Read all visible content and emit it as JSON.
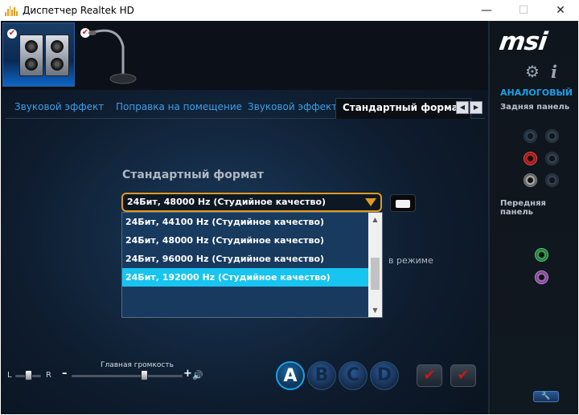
{
  "window": {
    "title": "Диспетчер Realtek HD",
    "minimize_symbol": "—",
    "maximize_symbol": "☐",
    "close_symbol": "✕"
  },
  "devices": [
    {
      "name": "speakers",
      "checked": true,
      "selected": true
    },
    {
      "name": "microphone",
      "checked": true,
      "selected": false
    }
  ],
  "tabs": [
    {
      "label": "Звуковой эффект",
      "active": false
    },
    {
      "label": "Поправка на помещение",
      "active": false
    },
    {
      "label": "Звуковой эффект",
      "active": false
    },
    {
      "label": "Стандартный формат",
      "active": true
    }
  ],
  "main": {
    "section_title": "Стандартный формат",
    "format_select": {
      "value": "24Бит, 48000 Hz (Студийное качество)",
      "options": [
        {
          "label": "24Бит, 44100 Hz (Студийное качество)",
          "selected": false
        },
        {
          "label": "24Бит, 48000 Hz (Студийное качество)",
          "selected": false
        },
        {
          "label": "24Бит, 96000 Hz (Студийное качество)",
          "selected": false
        },
        {
          "label": "24Бит, 192000 Hz (Студийное качество)",
          "selected": true
        }
      ]
    },
    "partially_hidden_text": "в режиме"
  },
  "volume": {
    "label": "Главная громкость",
    "balance_left": "L",
    "balance_right": "R",
    "minus": "–",
    "plus": "+",
    "balance_level": 0.5,
    "main_level": 0.5
  },
  "profiles": {
    "buttons": [
      "A",
      "B",
      "C",
      "D"
    ],
    "active": "A"
  },
  "right_panel": {
    "brand": "msi",
    "analog_label": "АНАЛОГОВЫЙ",
    "rear_panel_label": "Задняя панель",
    "front_panel_label": "Передняя панель",
    "rear_jacks": [
      "dim",
      "dim",
      "red",
      "dim",
      "black",
      "dim"
    ],
    "front_jacks": [
      "green",
      "pink"
    ]
  },
  "colors": {
    "accent_blue": "#18a0e6",
    "combo_border": "#e09a20",
    "selected_option": "#18c4f0",
    "background": "#121820"
  },
  "icons": {
    "settings": "gear-icon",
    "info": "info-icon",
    "speaker": "speaker-volume-icon",
    "wrench": "wrench-icon"
  }
}
